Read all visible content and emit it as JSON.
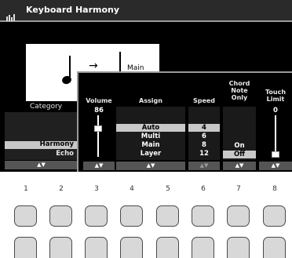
{
  "title": "Keyboard Harmony",
  "preview": {
    "label": "Main"
  },
  "category": {
    "label": "Category",
    "items": [
      "Harmony",
      "Echo"
    ],
    "selected": "Harmony"
  },
  "arrows": "▲▼",
  "columns": {
    "volume": {
      "header": "Volume",
      "value": "86",
      "level": 0.68
    },
    "assign": {
      "header": "Assign",
      "items": [
        "Auto",
        "Multi",
        "Main",
        "Layer"
      ],
      "selected": "Auto"
    },
    "speed": {
      "header": "Speed",
      "items": [
        "4",
        "6",
        "8",
        "12"
      ],
      "selected": "4"
    },
    "chord_note_only": {
      "header": "Chord Note Only",
      "items": [
        "On",
        "Off"
      ],
      "selected": "Off"
    },
    "touch_limit": {
      "header": "Touch Limit",
      "value": "0",
      "level": 0.05
    }
  },
  "buttons": [
    "1",
    "2",
    "3",
    "4",
    "5",
    "6",
    "7",
    "8"
  ],
  "colors": {
    "background": "#000000",
    "selection": "#c8c8c8",
    "button": "#d8d8d8"
  }
}
